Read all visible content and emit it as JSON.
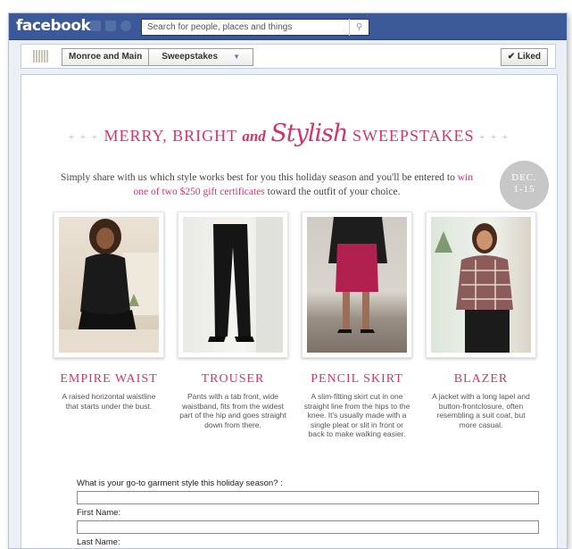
{
  "facebook": {
    "logo": "facebook",
    "search_placeholder": "Search for people, places and things"
  },
  "page_bar": {
    "page_name": "Monroe and Main",
    "tab_name": "Sweepstakes",
    "liked_label": "Liked"
  },
  "banner": {
    "stars_left": "+ + +",
    "title_part1": "MERRY, BRIGHT",
    "title_and": "and",
    "title_script": "Stylish",
    "title_part2": "SWEEPSTAKES",
    "stars_right": "+ + +",
    "intro_before": "Simply share with us which style works best for you this holiday season and you'll be entered to",
    "intro_highlight": "win one of two $250 gift certificates",
    "intro_after": "toward the outfit of your choice.",
    "date_line1": "DEC.",
    "date_line2": "1-15"
  },
  "products": [
    {
      "name": "EMPIRE WAIST",
      "description": "A raised horizontal waistline that starts under the bust."
    },
    {
      "name": "TROUSER",
      "description": "Pants with a tab front, wide waistband, fits from the widest part of the hip and goes straight down from there."
    },
    {
      "name": "PENCIL SKIRT",
      "description": "A slim-fitting skirt cut in one straight line from the hips to the knee. It's usually made with a single pleat or slit in front or back to make walking easier."
    },
    {
      "name": "BLAZER",
      "description": "A jacket with a long lapel and button-frontclosure, often resembling a suit coat, but more casual."
    }
  ],
  "form": {
    "question_label": "What is your go-to garment style this holiday season? :",
    "first_name_label": "First Name:",
    "last_name_label": "Last Name:"
  },
  "colors": {
    "facebook_blue": "#3b5998",
    "brand_pink": "#d2346f"
  }
}
